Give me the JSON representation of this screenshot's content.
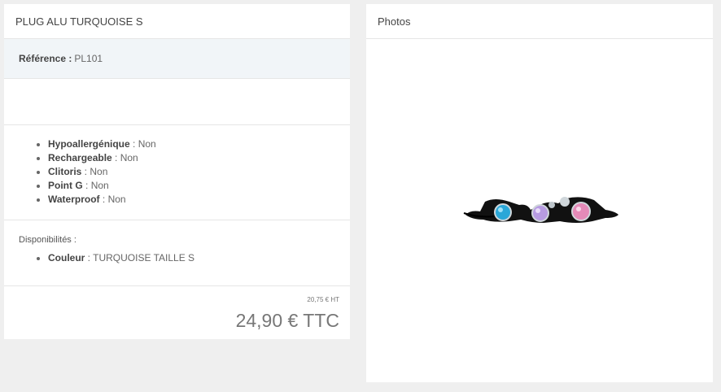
{
  "product": {
    "title": "PLUG ALU TURQUOISE S",
    "reference_label": "Référence :",
    "reference_value": "PL101",
    "features": [
      {
        "name": "Hypoallergénique",
        "value": "Non"
      },
      {
        "name": "Rechargeable",
        "value": "Non"
      },
      {
        "name": "Clitoris",
        "value": "Non"
      },
      {
        "name": "Point G",
        "value": "Non"
      },
      {
        "name": "Waterproof",
        "value": "Non"
      }
    ],
    "availability_title": "Disponibilités :",
    "availability": [
      {
        "name": "Couleur",
        "value": "TURQUOISE TAILLE S"
      }
    ],
    "price_ht": "20,75 € HT",
    "price_ttc": "24,90 € TTC"
  },
  "photos": {
    "title": "Photos"
  },
  "colors": {
    "turquoise": "#2aa7d8",
    "lilac": "#b79be2",
    "pink": "#e58ab8"
  }
}
